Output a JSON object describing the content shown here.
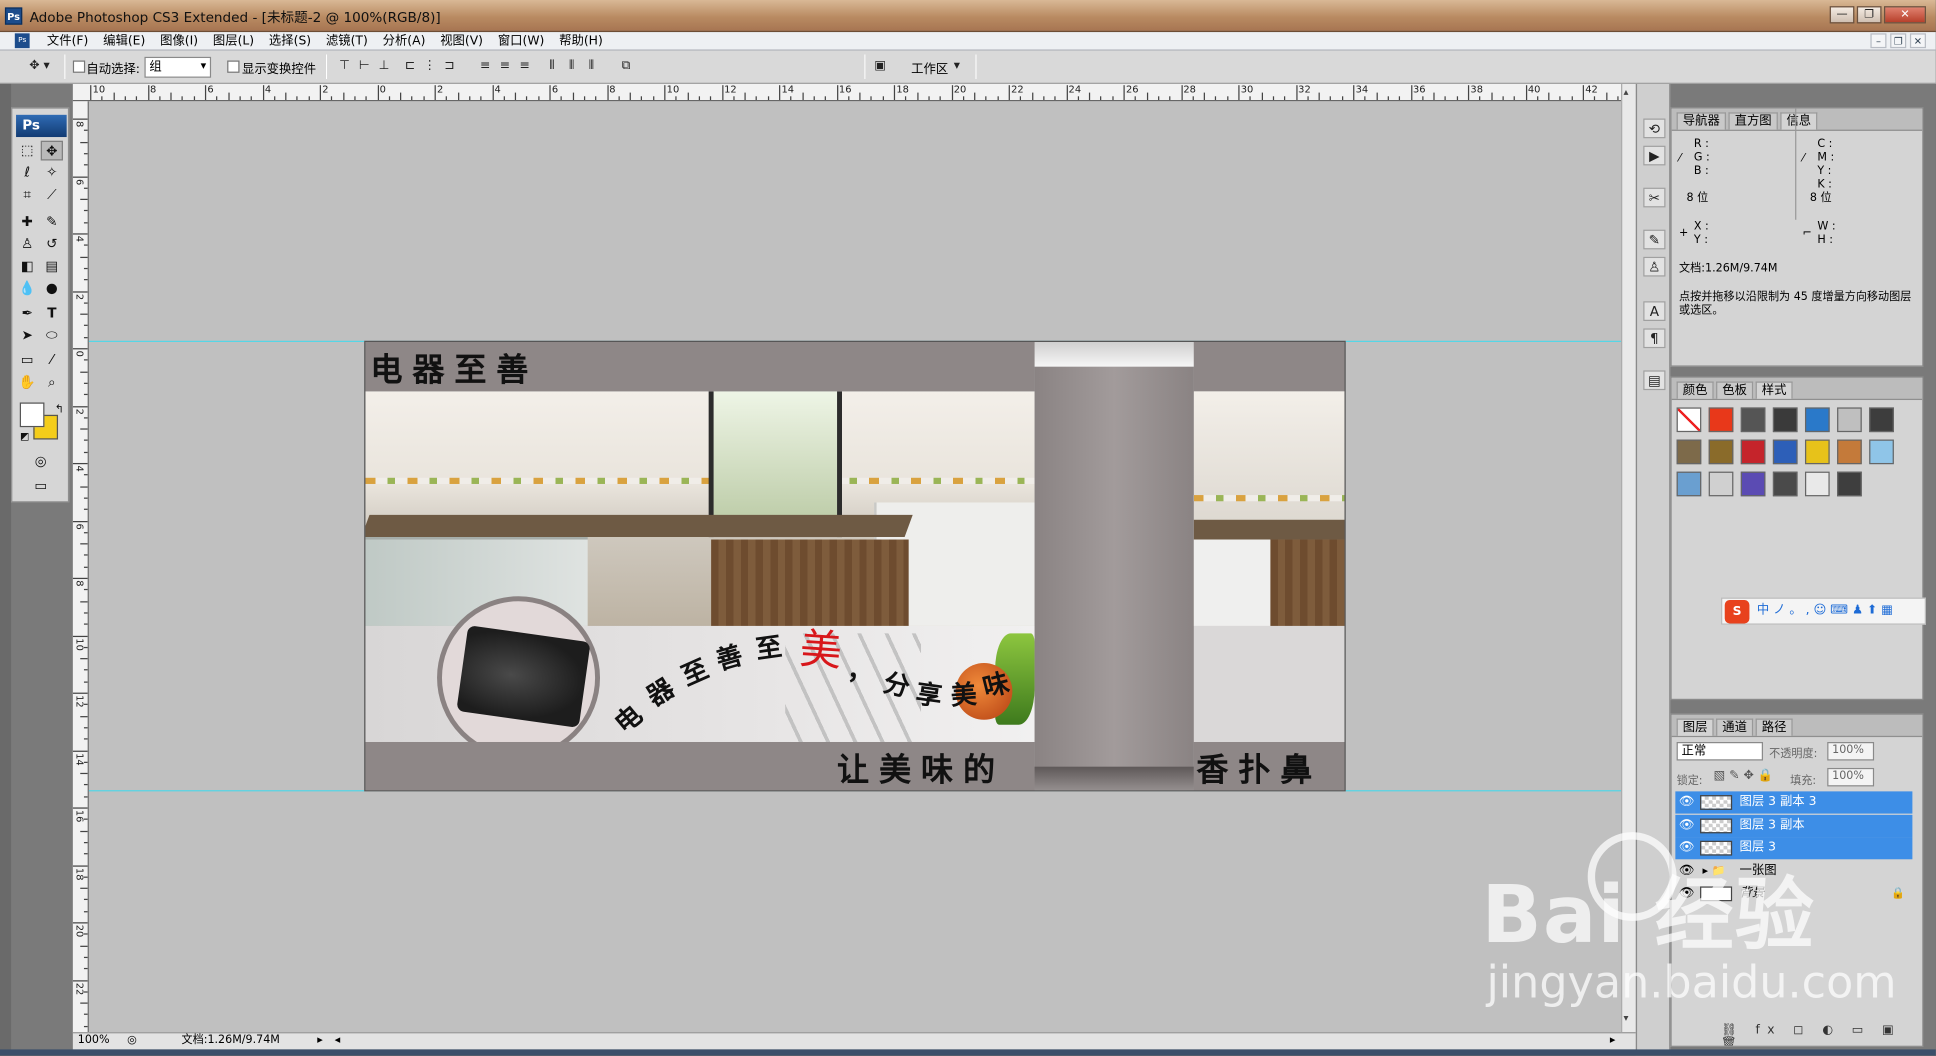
{
  "window": {
    "title": "Adobe Photoshop CS3 Extended - [未标题-2 @ 100%(RGB/8)]",
    "ps_icon": "Ps"
  },
  "menu": {
    "items": [
      "文件(F)",
      "编辑(E)",
      "图像(I)",
      "图层(L)",
      "选择(S)",
      "滤镜(T)",
      "分析(A)",
      "视图(V)",
      "窗口(W)",
      "帮助(H)"
    ]
  },
  "options": {
    "auto_select": "自动选择:",
    "auto_select_value": "组",
    "show_transform": "显示变换控件",
    "workspace": "工作区"
  },
  "toolbox": {
    "logo": "Ps"
  },
  "ruler": {
    "top": [
      "10",
      "8",
      "6",
      "4",
      "2",
      "0",
      "2",
      "4",
      "6",
      "8",
      "10",
      "12",
      "14",
      "16",
      "18",
      "20",
      "22",
      "24",
      "26",
      "28",
      "30",
      "32",
      "34",
      "36",
      "38",
      "40",
      "42",
      "44"
    ],
    "left": [
      "8",
      "6",
      "4",
      "2",
      "0",
      "2",
      "4",
      "6",
      "8",
      "10",
      "12",
      "14",
      "16",
      "18",
      "20",
      "22"
    ]
  },
  "document": {
    "title": "电器至善",
    "arc_chars": [
      "电",
      "器",
      "至",
      "善",
      "至"
    ],
    "accent_char": "美",
    "accent_color": "#d8171b",
    "comma": "，",
    "share": [
      "分",
      "享",
      "美",
      "味"
    ],
    "bottom_left": "让美味的",
    "bottom_right": "香扑鼻"
  },
  "status": {
    "zoom": "100%",
    "doc": "文档:1.26M/9.74M"
  },
  "info_panel": {
    "tabs": [
      "导航器",
      "直方图",
      "信息"
    ],
    "rgb": [
      "R :",
      "G :",
      "B :"
    ],
    "cmyk": [
      "C :",
      "M :",
      "Y :",
      "K :"
    ],
    "bits_left": "8 位",
    "bits_right": "8 位",
    "xy": [
      "X :",
      "Y :"
    ],
    "wh": [
      "W :",
      "H :"
    ],
    "doc": "文档:1.26M/9.74M",
    "hint": "点按并拖移以沿限制为 45 度增量方向移动图层或选区。"
  },
  "swatch_panel": {
    "tabs": [
      "颜色",
      "色板",
      "样式"
    ],
    "colors": [
      "#ffffff",
      "#e8381a",
      "#555555",
      "#3a3a3a",
      "#2a79c9",
      "#bfbfbf",
      "#3d3d3d",
      "#7d6a4a",
      "#8a6b2a",
      "#c5242b",
      "#2d5fb8",
      "#e7c21a",
      "#c47a3a",
      "#8fc5e8",
      "#6a9fd0",
      "#d0d0d0",
      "#5b4bb3",
      "#4a4a4a",
      "#e9e9e9",
      "#3e3e3e"
    ]
  },
  "layers_panel": {
    "tabs": [
      "图层",
      "通道",
      "路径"
    ],
    "blend": "正常",
    "opacity_label": "不透明度:",
    "opacity": "100%",
    "lock_label": "锁定:",
    "fill_label": "填充:",
    "fill": "100%",
    "layers": [
      {
        "name": "图层 3 副本 3",
        "selected": true
      },
      {
        "name": "图层 3 副本",
        "selected": true
      },
      {
        "name": "图层 3",
        "selected": true
      },
      {
        "name": "一张图",
        "selected": false
      },
      {
        "name": "背景",
        "selected": false
      }
    ]
  },
  "ime": {
    "logo": "S",
    "text": "中 ノ 。 , ☺ ⌨ ♟ ⬆ ▦"
  },
  "watermark": {
    "big": "Bai  经验",
    "small": "jingyan.baidu.com"
  }
}
